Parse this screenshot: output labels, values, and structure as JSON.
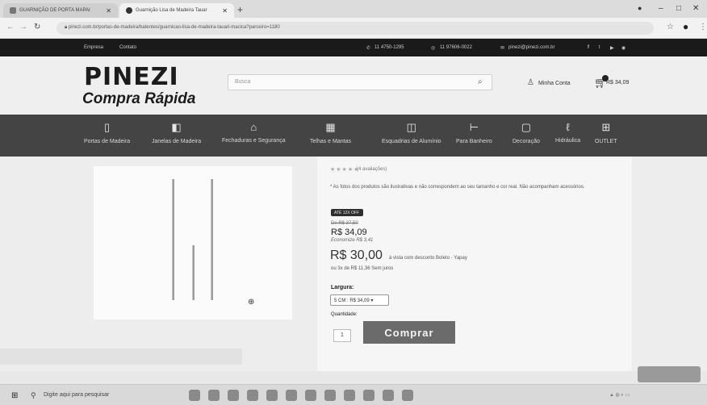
{
  "browser": {
    "tabs": [
      {
        "label": "GUARNIÇÃO DE PORTA MAPAI"
      },
      {
        "label": "Guarnição Lisa de Madeira Tauar"
      }
    ],
    "new_tab": "+",
    "url": "pinezi.com.br/portas-de-madeira/batentes/guarnicao-lisa-de-madeira-tauari-macica?parceiro=1180",
    "window_controls": {
      "minimize": "–",
      "maximize": "□",
      "close": "✕"
    }
  },
  "topbar": {
    "links": [
      "Empresa",
      "Contato"
    ],
    "phone1": "11 4750-1295",
    "phone2": "11 97606-0022",
    "email": "pinezi@pinezi.com.br"
  },
  "header": {
    "logo_line1": "PINEZI",
    "logo_line2": "Compra Rápida",
    "search_placeholder": "Busca",
    "account_label": "Minha Conta",
    "cart_total": "R$ 34,09"
  },
  "categories": [
    {
      "label": "Portas de Madeira",
      "icon": "door-icon"
    },
    {
      "label": "Janelas de Madeira",
      "icon": "window-icon"
    },
    {
      "label": "Fechaduras e Segurança",
      "icon": "lock-icon"
    },
    {
      "label": "Telhas e Mantas",
      "icon": "roof-tile-icon"
    },
    {
      "label": "Esquadrias de Alumínio",
      "icon": "frame-icon"
    },
    {
      "label": "Para Banheiro",
      "icon": "shower-icon"
    },
    {
      "label": "Decoração",
      "icon": "frame-decor-icon"
    },
    {
      "label": "Hidráulica",
      "icon": "faucet-icon"
    },
    {
      "label": "OUTLET",
      "icon": "gift-icon"
    }
  ],
  "product": {
    "stars": "★★★★★",
    "reviews": "(4 avaliações)",
    "note": "* As fotos dos produtos são ilustrativas e não correspondem ao seu tamanho e cor real. Não acompanham acessórios.",
    "discount_badge": "ATÉ 12X OFF",
    "old_price": "De R$ 37,50",
    "price": "R$ 34,09",
    "economize": "Economize R$ 3,41",
    "cash_price": "R$ 30,00",
    "cash_note": "à vista com desconto Boleto - Yapay",
    "installments": "ou 3x de R$ 11,36 Sem juros",
    "width_label": "Largura:",
    "width_option": "5 CM : R$ 34,09 ▾",
    "qty_label": "Quantidade:",
    "qty_value": "1",
    "buy_label": "Comprar"
  },
  "taskbar": {
    "search_placeholder": "Digite aqui para pesquisar"
  }
}
